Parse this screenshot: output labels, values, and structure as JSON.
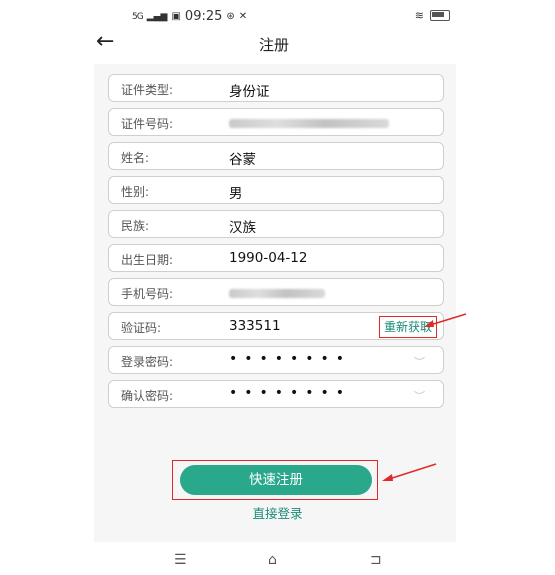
{
  "status_bar": {
    "signal": "5G",
    "time": "09:25"
  },
  "header": {
    "back_icon": "arrow-left-icon",
    "title": "注册"
  },
  "form": {
    "fields": [
      {
        "label": "证件类型:",
        "value": "身份证"
      },
      {
        "label": "证件号码:",
        "value": ""
      },
      {
        "label": "姓名:",
        "value": "谷蒙"
      },
      {
        "label": "性别:",
        "value": "男"
      },
      {
        "label": "民族:",
        "value": "汉族"
      },
      {
        "label": "出生日期:",
        "value": "1990-04-12"
      },
      {
        "label": "手机号码:",
        "value": ""
      },
      {
        "label": "验证码:",
        "value": "333511"
      },
      {
        "label": "登录密码:",
        "value": "••••••••"
      },
      {
        "label": "确认密码:",
        "value": "••••••••"
      }
    ],
    "refetch_code_label": "重新获取"
  },
  "actions": {
    "quick_register_label": "快速注册",
    "direct_login_label": "直接登录"
  },
  "colors": {
    "accent": "#2aa88c",
    "link": "#1b8b78",
    "annotation": "#e02a2a"
  }
}
